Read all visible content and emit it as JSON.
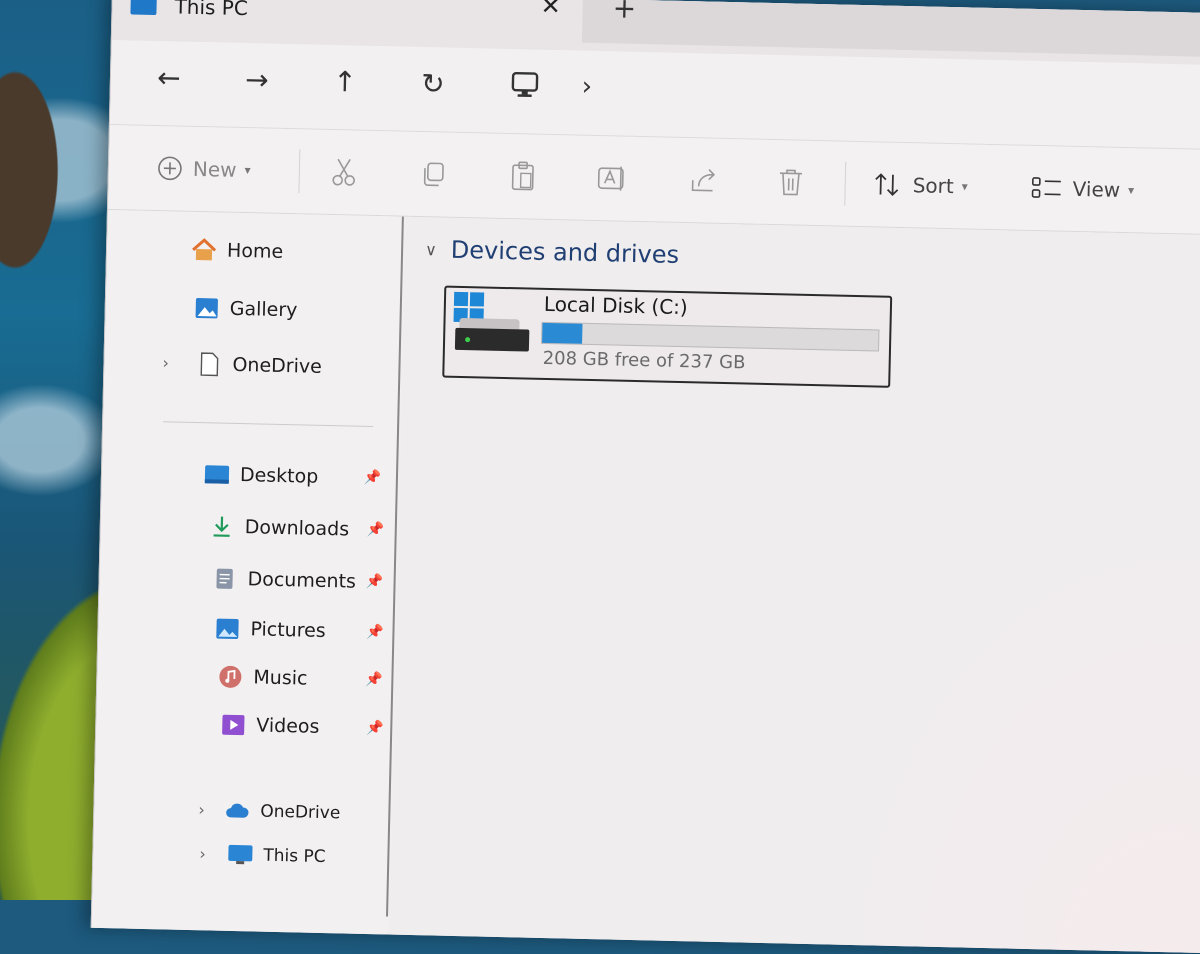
{
  "window": {
    "tab_title": "This PC",
    "tab_close_icon": "✕",
    "tab_add_icon": "+"
  },
  "navigation": {
    "back_icon": "←",
    "forward_icon": "→",
    "up_icon": "↑",
    "refresh_icon": "↻",
    "breadcrumb_chevron": "›"
  },
  "toolbar": {
    "new_label": "New",
    "sort_label": "Sort",
    "view_label": "View"
  },
  "sidebar": {
    "top_items": [
      {
        "label": "Home",
        "icon": "home-icon"
      },
      {
        "label": "Gallery",
        "icon": "gallery-icon"
      },
      {
        "label": "OneDrive",
        "icon": "file-icon"
      }
    ],
    "pinned_items": [
      {
        "label": "Desktop",
        "icon": "desktop-icon"
      },
      {
        "label": "Downloads",
        "icon": "download-icon"
      },
      {
        "label": "Documents",
        "icon": "documents-icon"
      },
      {
        "label": "Pictures",
        "icon": "pictures-icon"
      },
      {
        "label": "Music",
        "icon": "music-icon"
      },
      {
        "label": "Videos",
        "icon": "videos-icon"
      }
    ],
    "bottom_items": [
      {
        "label": "OneDrive",
        "icon": "cloud-icon"
      },
      {
        "label": "This PC",
        "icon": "computer-icon"
      }
    ]
  },
  "content": {
    "section_title": "Devices and drives",
    "drives": [
      {
        "name": "Local Disk (C:)",
        "free_text": "208 GB free of 237 GB",
        "used_fraction": 0.12
      }
    ]
  },
  "colors": {
    "accent": "#2a8ad3",
    "section_title": "#1f3f73"
  }
}
